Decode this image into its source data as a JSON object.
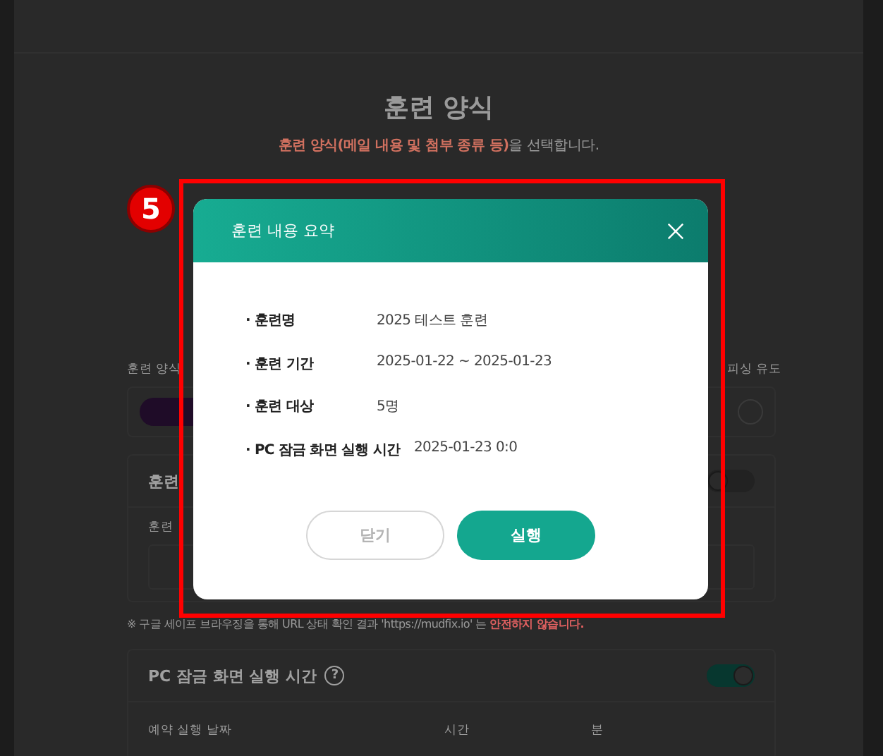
{
  "page": {
    "title": "훈련 양식",
    "subtitle": "**훈련 양식(메일 내용 및 첨부 종류 등)**을 선택합니다.",
    "form_label": "훈련 양식",
    "right_label": "피싱 유도",
    "url_section": {
      "title": "훈련",
      "toggle_on": false,
      "field_label": "훈련"
    },
    "note": "※ 구글 세이프 브라우징을 통해 URL 상태 확인 결과 'https://mudfix.io' 는 **안전하지 않습니다.**",
    "lock_section": {
      "title": "PC 잠금 화면 실행 시간",
      "help": "?",
      "toggle_on": true,
      "columns": [
        "예약 실행 날짜",
        "시간",
        "분"
      ]
    }
  },
  "annotation": {
    "number": "5"
  },
  "dialog": {
    "title": "훈련 내용 요약",
    "rows": [
      {
        "label": "· 훈련명",
        "value": "2025 테스트 훈련"
      },
      {
        "label": "· 훈련 기간",
        "value": "2025-01-22 ~ 2025-01-23"
      },
      {
        "label": "· 훈련 대상",
        "value": "5명"
      },
      {
        "label": "· PC 잠금 화면 실행 시간",
        "value": "2025-01-23 0:0"
      }
    ],
    "buttons": [
      {
        "label": "닫기",
        "kind": "secondary"
      },
      {
        "label": "실행",
        "kind": "primary"
      }
    ]
  }
}
